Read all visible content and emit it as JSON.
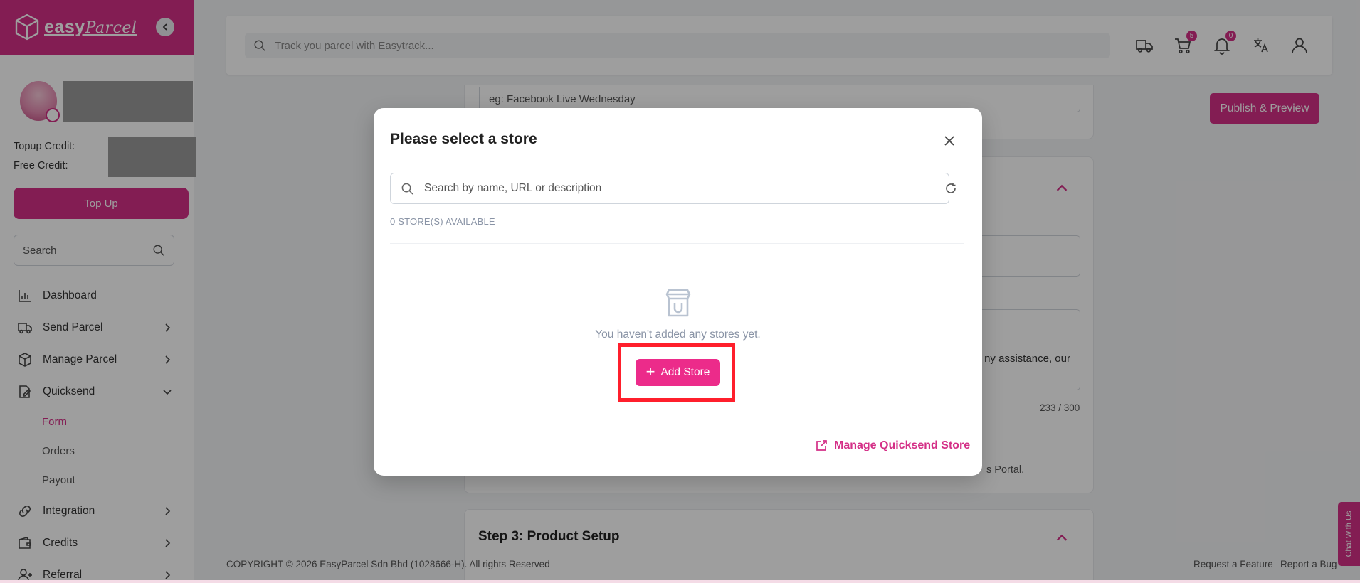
{
  "brand": {
    "name": "easy",
    "name_script": "Parcel",
    "primary_color": "#d42f87"
  },
  "sidebar": {
    "topup_credit_label": "Topup Credit:",
    "free_credit_label": "Free Credit:",
    "topup_button": "Top Up",
    "search_placeholder": "Search",
    "items": [
      {
        "label": "Dashboard",
        "icon": "bar-chart-icon"
      },
      {
        "label": "Send Parcel",
        "icon": "truck-icon"
      },
      {
        "label": "Manage Parcel",
        "icon": "box-icon"
      },
      {
        "label": "Quicksend",
        "icon": "edit-icon"
      },
      {
        "label": "Integration",
        "icon": "link-icon"
      },
      {
        "label": "Credits",
        "icon": "wallet-icon"
      },
      {
        "label": "Referral",
        "icon": "user-plus-icon"
      }
    ],
    "quicksend_sub": [
      "Form",
      "Orders",
      "Payout"
    ]
  },
  "topbar": {
    "track_placeholder": "Track you parcel with Easytrack...",
    "cart_count": "5",
    "notification_count": "0"
  },
  "page": {
    "publish_button": "Publish & Preview",
    "field_placeholder": "eg: Facebook Live Wednesday",
    "textarea_fragment": "ny assistance, our",
    "char_count": "233 / 300",
    "portal_fragment": "s Portal.",
    "step3_title": "Step 3: Product Setup",
    "copyright": "COPYRIGHT © 2026 EasyParcel Sdn Bhd (1028666-H). All rights Reserved",
    "request_feature": "Request a Feature",
    "report_bug": "Report a Bug",
    "chat_label": "Chat With Us"
  },
  "modal": {
    "title": "Please select a store",
    "search_placeholder": "Search by name, URL or description",
    "store_count": "0 STORE(S) AVAILABLE",
    "empty_message": "You haven't added any stores yet.",
    "add_store_button": "Add Store",
    "manage_link": "Manage Quicksend Store"
  }
}
